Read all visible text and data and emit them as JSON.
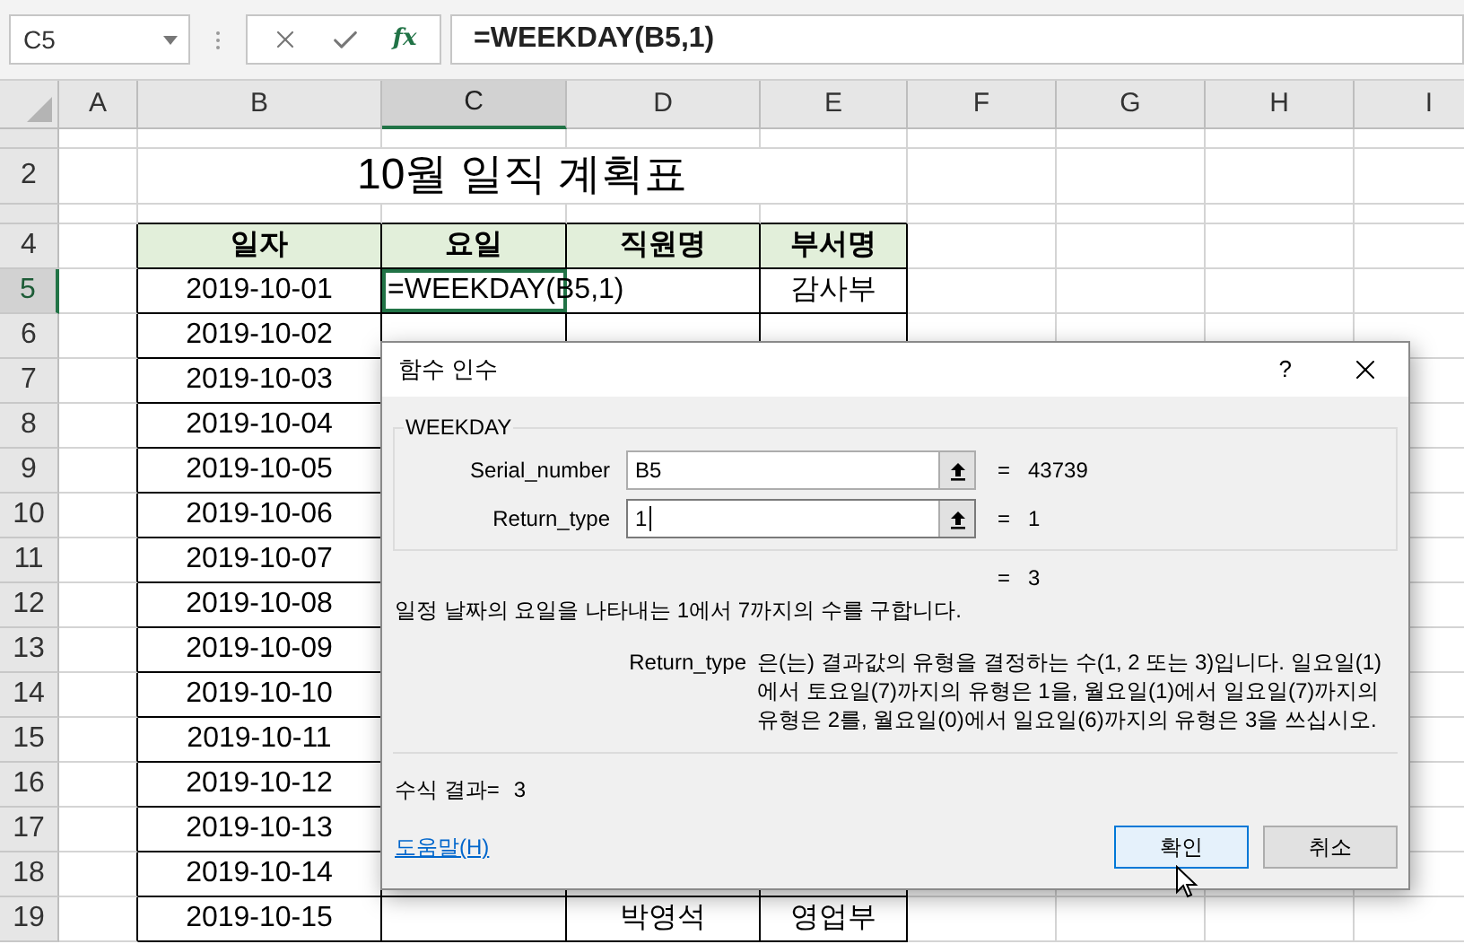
{
  "name_box": {
    "value": "C5"
  },
  "formula_bar": {
    "fx": "fx",
    "formula": "=WEEKDAY(B5,1)"
  },
  "columns": [
    {
      "label": "A",
      "selected": false
    },
    {
      "label": "B",
      "selected": false
    },
    {
      "label": "C",
      "selected": true
    },
    {
      "label": "D",
      "selected": false
    },
    {
      "label": "E",
      "selected": false
    },
    {
      "label": "F",
      "selected": false
    },
    {
      "label": "G",
      "selected": false
    },
    {
      "label": "H",
      "selected": false
    },
    {
      "label": "I",
      "selected": false
    }
  ],
  "rows": [
    {
      "kind": "thin",
      "selected": false
    },
    {
      "kind": "tall",
      "label": "2",
      "selected": false
    },
    {
      "kind": "thin",
      "selected": false
    },
    {
      "kind": "normal",
      "label": "4",
      "selected": false
    },
    {
      "kind": "normal",
      "label": "5",
      "selected": true
    },
    {
      "kind": "normal",
      "label": "6",
      "selected": false
    },
    {
      "kind": "normal",
      "label": "7",
      "selected": false
    },
    {
      "kind": "normal",
      "label": "8",
      "selected": false
    },
    {
      "kind": "normal",
      "label": "9",
      "selected": false
    },
    {
      "kind": "normal",
      "label": "10",
      "selected": false
    },
    {
      "kind": "normal",
      "label": "11",
      "selected": false
    },
    {
      "kind": "normal",
      "label": "12",
      "selected": false
    },
    {
      "kind": "normal",
      "label": "13",
      "selected": false
    },
    {
      "kind": "normal",
      "label": "14",
      "selected": false
    },
    {
      "kind": "normal",
      "label": "15",
      "selected": false
    },
    {
      "kind": "normal",
      "label": "16",
      "selected": false
    },
    {
      "kind": "normal",
      "label": "17",
      "selected": false
    },
    {
      "kind": "normal",
      "label": "18",
      "selected": false
    },
    {
      "kind": "normal",
      "label": "19",
      "selected": false
    }
  ],
  "title": "10월 일직 계획표",
  "table": {
    "headers": [
      "일자",
      "요일",
      "직원명",
      "부서명"
    ],
    "rows": [
      {
        "date": "2019-10-01",
        "weekday": "=WEEKDAY(B5,1)",
        "department": "감사부",
        "active": true
      },
      {
        "date": "2019-10-02",
        "active": false
      },
      {
        "date": "2019-10-03",
        "active": false
      },
      {
        "date": "2019-10-04",
        "active": false
      },
      {
        "date": "2019-10-05",
        "active": false
      },
      {
        "date": "2019-10-06",
        "active": false
      },
      {
        "date": "2019-10-07",
        "active": false
      },
      {
        "date": "2019-10-08",
        "active": false
      },
      {
        "date": "2019-10-09",
        "active": false
      },
      {
        "date": "2019-10-10",
        "active": false
      },
      {
        "date": "2019-10-11",
        "active": false
      },
      {
        "date": "2019-10-12",
        "active": false
      },
      {
        "date": "2019-10-13",
        "active": false
      },
      {
        "date": "2019-10-14",
        "active": false
      },
      {
        "date": "2019-10-15",
        "employee": "박영석",
        "department": "영업부",
        "active": false
      }
    ]
  },
  "dialog": {
    "title": "함수 인수",
    "help": "?",
    "function_name": "WEEKDAY",
    "arguments": [
      {
        "label": "Serial_number",
        "value": "B5",
        "eq": "=",
        "result": "43739",
        "focused": false
      },
      {
        "label": "Return_type",
        "value": "1",
        "eq": "=",
        "result": "1",
        "focused": true
      }
    ],
    "formula_value": {
      "eq": "=",
      "value": "3"
    },
    "description": "일정 날짜의 요일을 나타내는 1에서 7까지의 수를 구합니다.",
    "argument_help": {
      "name": "Return_type",
      "text": "은(는) 결과값의 유형을 결정하는 수(1, 2 또는 3)입니다. 일요일(1)에서 토요일(7)까지의 유형은 1을, 월요일(1)에서 일요일(7)까지의 유형은 2를, 월요일(0)에서 일요일(6)까지의 유형은 3을 쓰십시오."
    },
    "result": {
      "label": "수식 결과=",
      "value": "3"
    },
    "help_link": "도움말(H)",
    "buttons": [
      {
        "label": "확인",
        "default": true
      },
      {
        "label": "취소",
        "default": false
      }
    ]
  }
}
